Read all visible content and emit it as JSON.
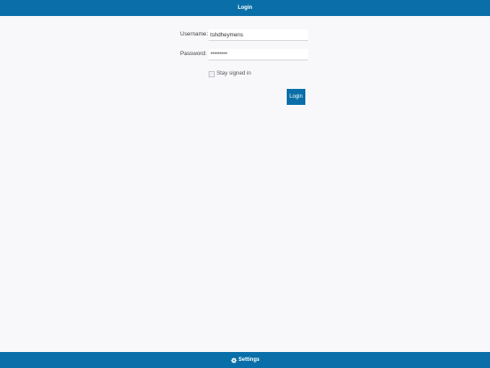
{
  "header": {
    "title": "Login"
  },
  "form": {
    "username_label": "Username:",
    "username_value": "tshdheymens",
    "password_label": "Password:",
    "password_value": "*********",
    "stay_signed_in_label": "Stay signed in",
    "stay_signed_in_checked": false,
    "login_button_label": "Login"
  },
  "footer": {
    "settings_label": "Settings",
    "settings_icon": "gear-icon"
  },
  "colors": {
    "accent": "#0a6fa8",
    "background": "#f8f8fb"
  }
}
